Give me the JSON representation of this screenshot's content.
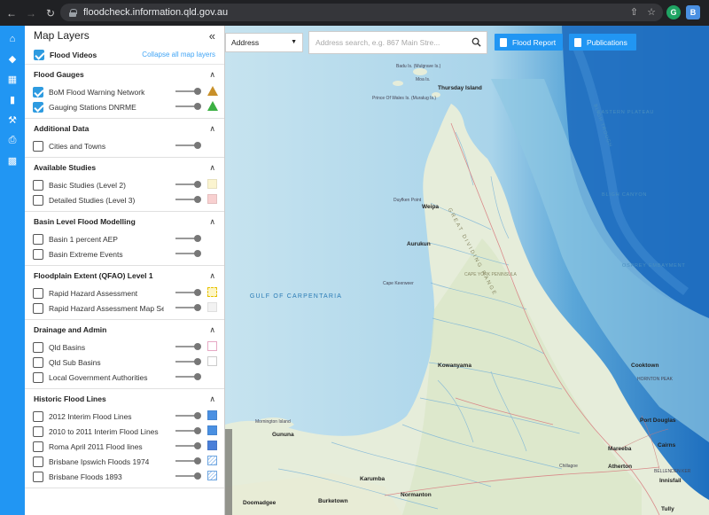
{
  "browser": {
    "url": "floodcheck.information.qld.gov.au",
    "ext_g": "G",
    "ext_b": "B"
  },
  "panel": {
    "title": "Map Layers",
    "flood_videos_label": "Flood Videos",
    "collapse_all_label": "Collapse all map layers",
    "sections": [
      {
        "title": "Flood Gauges",
        "rows": [
          {
            "label": "BoM Flood Warning Network",
            "checked": true,
            "swatch": "triangle-orange"
          },
          {
            "label": "Gauging Stations DNRME",
            "checked": true,
            "swatch": "triangle-green"
          }
        ]
      },
      {
        "title": "Additional Data",
        "rows": [
          {
            "label": "Cities and Towns",
            "checked": false,
            "swatch": "none"
          }
        ]
      },
      {
        "title": "Available Studies",
        "rows": [
          {
            "label": "Basic Studies (Level 2)",
            "checked": false,
            "swatch": "#fbf4cf"
          },
          {
            "label": "Detailed Studies (Level 3)",
            "checked": false,
            "swatch": "#f8d0d0"
          }
        ]
      },
      {
        "title": "Basin Level Flood Modelling",
        "rows": [
          {
            "label": "Basin 1 percent AEP",
            "checked": false,
            "swatch": "none"
          },
          {
            "label": "Basin Extreme Events",
            "checked": false,
            "swatch": "none"
          }
        ]
      },
      {
        "title": "Floodplain Extent (QFAO) Level 1",
        "rows": [
          {
            "label": "Rapid Hazard Assessment",
            "checked": false,
            "swatch": "dashed-yellow"
          },
          {
            "label": "Rapid Hazard Assessment Map Se...",
            "checked": false,
            "swatch": "#f2f2f2"
          }
        ]
      },
      {
        "title": "Drainage and Admin",
        "rows": [
          {
            "label": "Qld Basins",
            "checked": false,
            "swatch": "outline-pink"
          },
          {
            "label": "Qld Sub Basins",
            "checked": false,
            "swatch": "outline-grey"
          },
          {
            "label": "Local Government Authorities",
            "checked": false,
            "swatch": "none"
          }
        ]
      },
      {
        "title": "Historic Flood Lines",
        "rows": [
          {
            "label": "2012 Interim Flood Lines",
            "checked": false,
            "swatch": "#4a90e2"
          },
          {
            "label": "2010 to 2011 Interim Flood Lines",
            "checked": false,
            "swatch": "#4a90e2"
          },
          {
            "label": "Roma April 2011 Flood lines",
            "checked": false,
            "swatch": "#4a7fd8"
          },
          {
            "label": "Brisbane Ipswich Floods 1974",
            "checked": false,
            "swatch": "hatch"
          },
          {
            "label": "Brisbane Floods 1893",
            "checked": false,
            "swatch": "hatch"
          }
        ]
      }
    ]
  },
  "map_controls": {
    "address_select": "Address",
    "search_placeholder": "Address search, e.g. 867 Main Stre...",
    "flood_report_label": "Flood Report",
    "publications_label": "Publications"
  },
  "map_labels": {
    "badu": "Badu Is. (Mulgrave Is.)",
    "moa": "Moa Is.",
    "prince_of_wales": "Prince Of Wales Is. (Muralug Is.)",
    "thursday_island": "Thursday Island",
    "great_dividing": "GREAT DIVIDING RANGE",
    "eastern_plateau": "EASTERN PLATEAU",
    "bligh_trough": "BLIGH TROUGH",
    "bligh_canyon": "BLIGH CANYON",
    "osprey": "OSPREY EMBAYMENT",
    "duyfken_point": "Duyfken Point",
    "weipa": "Weipa",
    "aurukun": "Aurukun",
    "cape_keerweer": "Cape Keerweer",
    "cape_york_peninsula": "CAPE YORK PENINSULA",
    "gulf": "GULF OF CARPENTARIA",
    "kowanyama": "Kowanyama",
    "cooktown": "Cooktown",
    "hornton_peak": "HORNTON PEAK",
    "port_douglas": "Port Douglas",
    "mornington": "Mornington Island",
    "gununa": "Gununa",
    "mareeba": "Mareeba",
    "cairns": "Cairns",
    "chillagoe": "Chillagoe",
    "atherton": "Atherton",
    "innisfail": "Innisfail",
    "karumba": "Karumba",
    "normanton": "Normanton",
    "doomadgee": "Doomadgee",
    "burketown": "Burketown",
    "tully": "Tully",
    "bellenden": "BELLENDEN KER"
  }
}
